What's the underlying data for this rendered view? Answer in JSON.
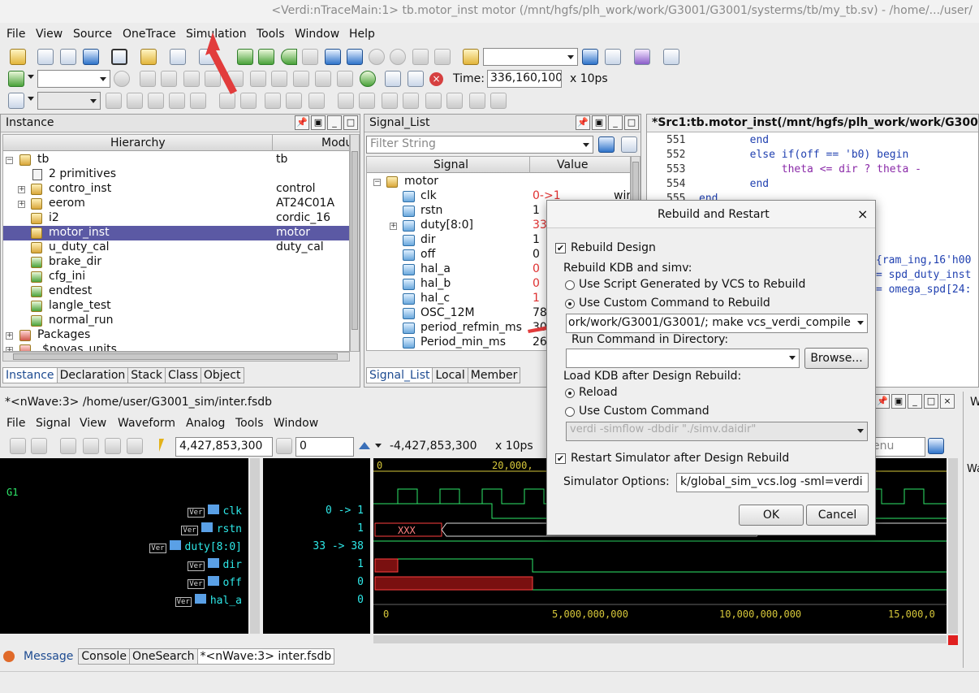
{
  "window_title": "<Verdi:nTraceMain:1> tb.motor_inst motor (/mnt/hgfs/plh_work/work/G3001/G3001/systerms/tb/my_tb.sv) - /home/.../user/",
  "menu": [
    "File",
    "View",
    "Source",
    "OneTrace",
    "Simulation",
    "Tools",
    "Window",
    "Help"
  ],
  "toolbar": {
    "time_label": "Time:",
    "time_value": "336,160,100",
    "time_unit": "x 10ps"
  },
  "instance_panel": {
    "title": "Instance",
    "col_hierarchy": "Hierarchy",
    "col_module": "Modu",
    "rows": [
      {
        "name": "tb",
        "module": "tb"
      },
      {
        "name": "2 primitives",
        "module": ""
      },
      {
        "name": "contro_inst",
        "module": "control"
      },
      {
        "name": "eerom",
        "module": "AT24C01A"
      },
      {
        "name": "i2",
        "module": "cordic_16"
      },
      {
        "name": "motor_inst",
        "module": "motor"
      },
      {
        "name": "u_duty_cal",
        "module": "duty_cal"
      },
      {
        "name": "brake_dir",
        "module": ""
      },
      {
        "name": "cfg_ini",
        "module": ""
      },
      {
        "name": "endtest",
        "module": ""
      },
      {
        "name": "langle_test",
        "module": ""
      },
      {
        "name": "normal_run",
        "module": ""
      },
      {
        "name": "Packages",
        "module": ""
      },
      {
        "name": "$novas_units",
        "module": ""
      }
    ],
    "tabs": [
      "Instance",
      "Declaration",
      "Stack",
      "Class",
      "Object"
    ]
  },
  "signal_panel": {
    "title": "Signal_List",
    "filter_placeholder": "Filter String",
    "col_signal": "Signal",
    "col_value": "Value",
    "group": "motor",
    "rows": [
      {
        "name": "clk",
        "value": "0->1",
        "extra": "wir"
      },
      {
        "name": "rstn",
        "value": "1"
      },
      {
        "name": "duty[8:0]",
        "value": "33"
      },
      {
        "name": "dir",
        "value": "1"
      },
      {
        "name": "off",
        "value": "0"
      },
      {
        "name": "hal_a",
        "value": "0"
      },
      {
        "name": "hal_b",
        "value": "0"
      },
      {
        "name": "hal_c",
        "value": "1"
      },
      {
        "name": "OSC_12M",
        "value": "78"
      },
      {
        "name": "period_refmin_ms",
        "value": "30"
      },
      {
        "name": "Period_min_ms",
        "value": "26"
      }
    ],
    "tabs": [
      "Signal_List",
      "Local",
      "Member"
    ]
  },
  "source_panel": {
    "title": "*Src1:tb.motor_inst(/mnt/hgfs/plh_work/work/G300",
    "lines": [
      {
        "num": "551",
        "code": "        end"
      },
      {
        "num": "552",
        "code": "        else if(off == 'b0) begin"
      },
      {
        "num": "553",
        "code": "             theta <= dir ? theta -"
      },
      {
        "num": "554",
        "code": "        end"
      },
      {
        "num": "555",
        "code": "end"
      }
    ],
    "fragments": [
      "{ram_ing,16'h00",
      "= spd_duty_inst",
      "= omega_spd[24:"
    ]
  },
  "nwave": {
    "title": "*<nWave:3> /home/user/G3001_sim/inter.fsdb",
    "menu": [
      "File",
      "Signal",
      "View",
      "Waveform",
      "Analog",
      "Tools",
      "Window"
    ],
    "cursor": "4,427,853,300",
    "marker": "0",
    "delta": "-4,427,853,300",
    "unit": "x 10ps",
    "group": "G1",
    "signals": [
      {
        "tag": "Ver",
        "name": "clk",
        "value": "0 -> 1"
      },
      {
        "tag": "Ver",
        "name": "rstn",
        "value": "1"
      },
      {
        "tag": "Ver",
        "name": "duty[8:0]",
        "value": "33 -> 38"
      },
      {
        "tag": "Ver",
        "name": "dir",
        "value": "1"
      },
      {
        "tag": "Ver",
        "name": "off",
        "value": "0"
      },
      {
        "tag": "Ver",
        "name": "hal_a",
        "value": "0"
      }
    ],
    "top_ruler": [
      "0",
      "20,000,"
    ],
    "bottom_ruler": [
      "0",
      "5,000,000,000",
      "10,000,000,000",
      "15,000,0"
    ],
    "bus_values": [
      "XXX",
      "0",
      "5"
    ],
    "menu_placeholder": "enu"
  },
  "bottom_tabs": [
    "Message",
    "Console",
    "OneSearch",
    "*<nWave:3> inter.fsdb"
  ],
  "dialog": {
    "title": "Rebuild and Restart",
    "close": "×",
    "rebuild_design": "Rebuild Design",
    "rebuild_kdb_label": "Rebuild KDB and simv:",
    "opt_script": "Use Script Generated by VCS to Rebuild",
    "opt_custom": "Use Custom Command to Rebuild",
    "custom_command": "ork/work/G3001/G3001/; make vcs_verdi_compile",
    "run_in_dir_label": "Run Command in Directory:",
    "browse": "Browse...",
    "load_kdb_label": "Load KDB after Design Rebuild:",
    "opt_reload": "Reload",
    "opt_custom_cmd": "Use Custom Command",
    "custom_cmd_value": "verdi -simflow -dbdir \"./simv.daidir\"",
    "restart": "Restart Simulator after Design Rebuild",
    "sim_options_label": "Simulator Options:",
    "sim_options_value": "k/global_sim_vcs.log -sml=verdi",
    "ok": "OK",
    "cancel": "Cancel"
  },
  "side_fragments": [
    "W",
    "Wa"
  ],
  "colors": {
    "selection": "#5b59a4",
    "wave_green": "#2ee86a",
    "wave_red": "#ff4040",
    "arrow": "#e23c3c"
  }
}
